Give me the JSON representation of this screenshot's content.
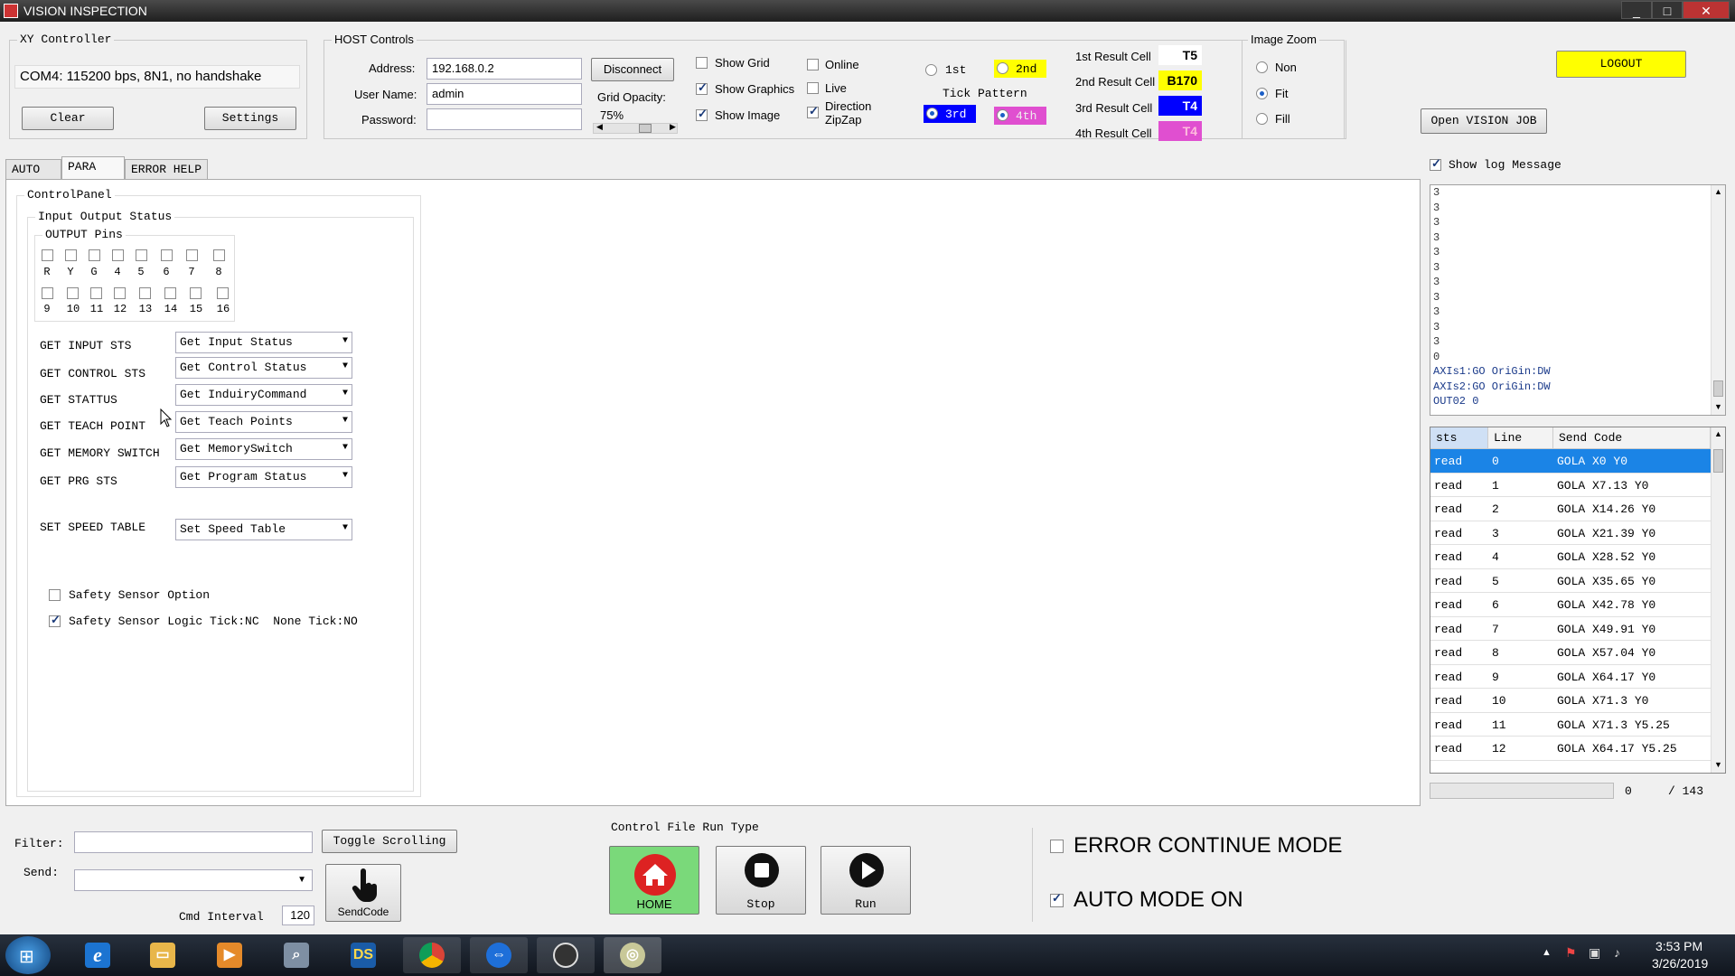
{
  "window": {
    "title": "VISION INSPECTION",
    "min": "_",
    "max": "□",
    "close": "✕"
  },
  "xy": {
    "title": "XY Controller",
    "port": "COM4: 115200 bps, 8N1, no handshake",
    "clear": "Clear",
    "settings": "Settings"
  },
  "host": {
    "title": "HOST Controls",
    "address_label": "Address:",
    "address": "192.168.0.2",
    "user_label": "User Name:",
    "user": "admin",
    "password_label": "Password:",
    "password": "",
    "disconnect": "Disconnect",
    "grid_opacity_label": "Grid Opacity:",
    "grid_opacity": "75%",
    "show_grid": "Show Grid",
    "show_graphics": "Show Graphics",
    "show_image": "Show Image",
    "online": "Online",
    "live": "Live",
    "direction": "Direction",
    "zipzap": "ZipZap",
    "tick_pattern": "Tick Pattern",
    "t1": "1st",
    "t2": "2nd",
    "t3": "3rd",
    "t4": "4th",
    "r1_label": "1st Result Cell",
    "r1": "T5",
    "r2_label": "2nd Result Cell",
    "r2": "B170",
    "r3_label": "3rd Result Cell",
    "r3": "T4",
    "r4_label": "4th Result Cell",
    "r4": "T4"
  },
  "zoom": {
    "title": "Image Zoom",
    "non": "Non",
    "fit": "Fit",
    "fill": "Fill"
  },
  "logout": "LOGOUT",
  "open_job": "Open VISION JOB",
  "show_log": "Show log Message",
  "tabs": {
    "auto": "AUTO",
    "para": "PARA",
    "error": "ERROR HELP"
  },
  "control": {
    "title": "ControlPanel",
    "io_title": "Input Output Status",
    "pins_title": "OUTPUT Pins",
    "pins_row1": [
      "R",
      "Y",
      "G",
      "4",
      "5",
      "6",
      "7",
      "8"
    ],
    "pins_row2": [
      "9",
      "10",
      "11",
      "12",
      "13",
      "14",
      "15",
      "16"
    ],
    "labels": [
      "GET INPUT STS",
      "GET CONTROL STS",
      "GET STATTUS",
      "GET TEACH POINT",
      "GET MEMORY SWITCH",
      "GET PRG STS"
    ],
    "combos": [
      "Get Input Status",
      "Get Control Status",
      "Get InduiryCommand",
      "Get Teach Points",
      "Get MemorySwitch",
      "Get Program Status"
    ],
    "speed_label": "SET SPEED TABLE",
    "speed_combo": "Set Speed Table",
    "safety1": "Safety Sensor Option",
    "safety2": "Safety Sensor Logic Tick:NC  None Tick:NO"
  },
  "log": [
    "3",
    "3",
    "3",
    "3",
    "3",
    "3",
    "3",
    "3",
    "3",
    "3",
    "3",
    "0",
    "AXIs1:GO OriGin:DW",
    "AXIs2:GO OriGin:DW",
    "OUT02 0"
  ],
  "grid": {
    "headers": [
      "sts",
      "Line",
      "Send Code"
    ],
    "rows": [
      [
        "read",
        "0",
        "GOLA X0 Y0"
      ],
      [
        "read",
        "1",
        "GOLA X7.13 Y0"
      ],
      [
        "read",
        "2",
        "GOLA X14.26 Y0"
      ],
      [
        "read",
        "3",
        "GOLA X21.39 Y0"
      ],
      [
        "read",
        "4",
        "GOLA X28.52 Y0"
      ],
      [
        "read",
        "5",
        "GOLA X35.65 Y0"
      ],
      [
        "read",
        "6",
        "GOLA X42.78 Y0"
      ],
      [
        "read",
        "7",
        "GOLA X49.91 Y0"
      ],
      [
        "read",
        "8",
        "GOLA X57.04 Y0"
      ],
      [
        "read",
        "9",
        "GOLA X64.17 Y0"
      ],
      [
        "read",
        "10",
        "GOLA X71.3 Y0"
      ],
      [
        "read",
        "11",
        "GOLA X71.3 Y5.25"
      ],
      [
        "read",
        "12",
        "GOLA X64.17 Y5.25"
      ]
    ],
    "progress_current": "0",
    "progress_total": "/ 143"
  },
  "bottom": {
    "filter_label": "Filter:",
    "send_label": "Send:",
    "toggle_scrolling": "Toggle Scrolling",
    "sendcode": "SendCode",
    "cmd_interval_label": "Cmd Interval",
    "cmd_interval": "120",
    "run_type_title": "Control File Run Type",
    "home": "HOME",
    "stop": "Stop",
    "run": "Run",
    "error_mode": "ERROR CONTINUE MODE",
    "auto_mode": "AUTO MODE ON"
  },
  "taskbar": {
    "time": "3:53 PM",
    "date": "3/26/2019"
  },
  "colors": {
    "yellow": "#ffff00",
    "blue": "#0000ff",
    "pink": "#e04fd0",
    "selection": "#1b84e6",
    "home_green": "#7ad97a"
  }
}
